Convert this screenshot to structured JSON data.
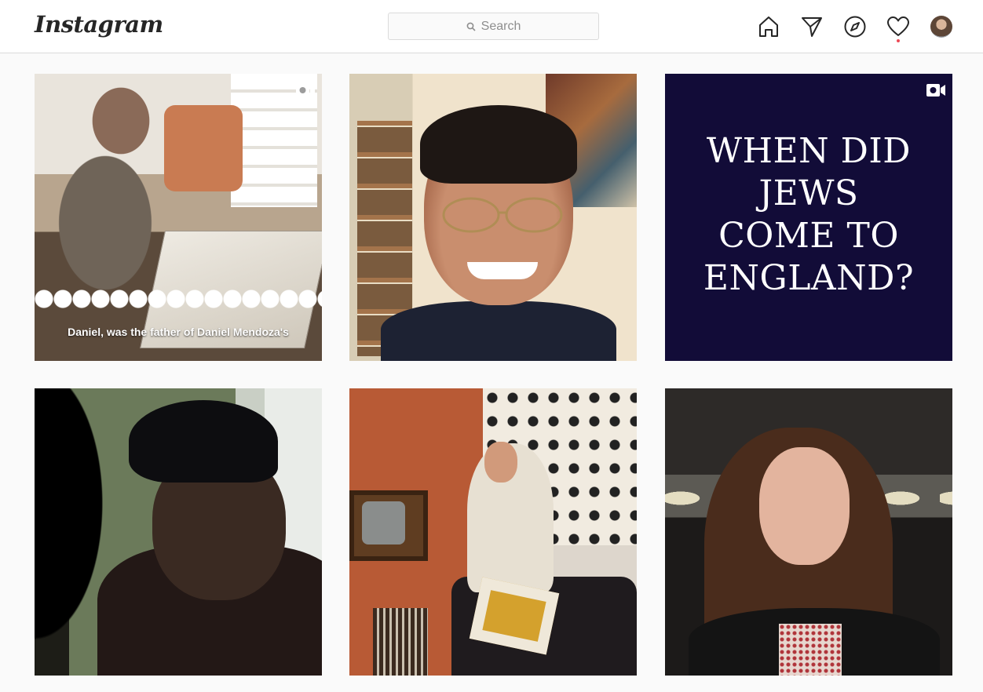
{
  "header": {
    "logo_text": "Instagram",
    "search_placeholder": "Search"
  },
  "nav": {
    "icons": [
      "home-icon",
      "direct-message-icon",
      "explore-compass-icon",
      "activity-heart-icon",
      "profile-avatar"
    ],
    "activity_dot_color": "#ed4956"
  },
  "posts": [
    {
      "kind": "video",
      "caption": "Daniel, was the father of Daniel Mendoza's"
    },
    {
      "kind": "photo"
    },
    {
      "kind": "video",
      "headline": [
        "WHEN DID",
        "JEWS",
        "COME TO",
        "ENGLAND?"
      ]
    },
    {
      "kind": "photo"
    },
    {
      "kind": "photo"
    },
    {
      "kind": "photo"
    }
  ],
  "colors": {
    "background": "#fafafa",
    "header_bg": "#ffffff",
    "border": "#dbdbdb",
    "text_dark": "#262626",
    "text_muted": "#8e8e8e",
    "headline_bg": "#120c38"
  }
}
